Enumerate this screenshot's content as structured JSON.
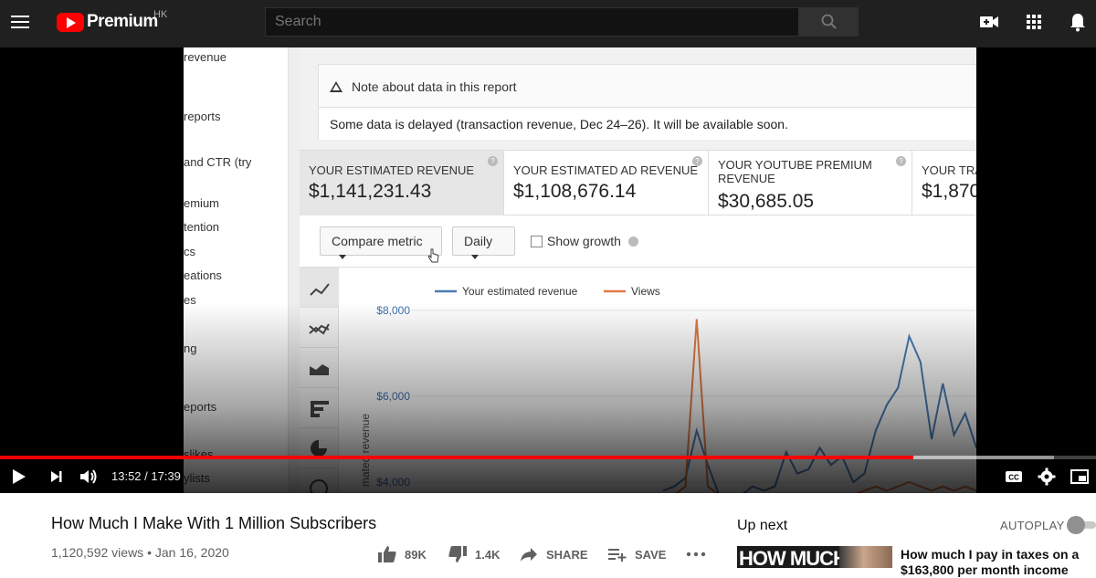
{
  "header": {
    "brand": "Premium",
    "region": "HK",
    "search_placeholder": "Search"
  },
  "embedded_studio": {
    "nav_items": [
      "revenue",
      "reports",
      "and CTR (try",
      "emium",
      "tention",
      "cs",
      "eations",
      "es",
      "ng",
      "eports",
      "slikes",
      "ylists"
    ],
    "notice_title": "Note about data in this report",
    "notice_message": "Some data is delayed (transaction revenue, Dec 24–26). It will be available soon.",
    "metric_cards": [
      {
        "label": "YOUR ESTIMATED REVENUE",
        "value": "$1,141,231.43"
      },
      {
        "label": "YOUR ESTIMATED AD REVENUE",
        "value": "$1,108,676.14"
      },
      {
        "label": "YOUR YOUTUBE PREMIUM REVENUE",
        "value": "$30,685.05"
      },
      {
        "label": "YOUR TRA",
        "value": "$1,870"
      }
    ],
    "compare_metric_label": "Compare metric",
    "daily_label": "Daily",
    "show_growth_label": "Show growth",
    "y_axis_title": "mated revenue"
  },
  "chart_data": {
    "type": "line",
    "legend": [
      "Your estimated revenue",
      "Views"
    ],
    "legend_placement": "top",
    "y_tick_labels": [
      "$8,000",
      "$6,000",
      "$4,000"
    ],
    "ylabel": "mated revenue",
    "series_colors": {
      "Your estimated revenue": "#4a7db5",
      "Views": "#e07b46"
    },
    "series": [
      {
        "name": "Your estimated revenue",
        "values": [
          3800,
          3900,
          4100,
          5200,
          4400,
          3700,
          3500,
          3700,
          3900,
          3800,
          3900,
          4700,
          4200,
          4300,
          4800,
          4400,
          4600,
          4000,
          4200,
          5200,
          5800,
          6200,
          7400,
          6800,
          5000,
          6300,
          5100,
          5600,
          4800
        ]
      },
      {
        "name": "Views",
        "values": [
          3700,
          3700,
          3900,
          7800,
          3900,
          3700,
          3700,
          3700,
          3700,
          3700,
          3700,
          3700,
          3700,
          3700,
          3700,
          3700,
          3700,
          3700,
          3800,
          3900,
          3800,
          3900,
          4000,
          3900,
          3800,
          3900,
          3800,
          3900,
          3800
        ]
      }
    ]
  },
  "player": {
    "current_time": "13:52",
    "duration": "17:39",
    "timecode": "13:52 / 17:39",
    "played_fraction": 0.833
  },
  "video": {
    "title": "How Much I Make With 1 Million Subscribers",
    "meta": "1,120,592 views • Jan 16, 2020",
    "likes": "89K",
    "dislikes": "1.4K",
    "share_label": "SHARE",
    "save_label": "SAVE"
  },
  "sidebar": {
    "up_next_label": "Up next",
    "autoplay_label": "AUTOPLAY",
    "next_thumb_text": "HOW MUCH",
    "next_title": "How much I pay in taxes on a $163,800 per month income"
  },
  "colors": {
    "accent": "#ff0000",
    "topbar": "#202020"
  }
}
